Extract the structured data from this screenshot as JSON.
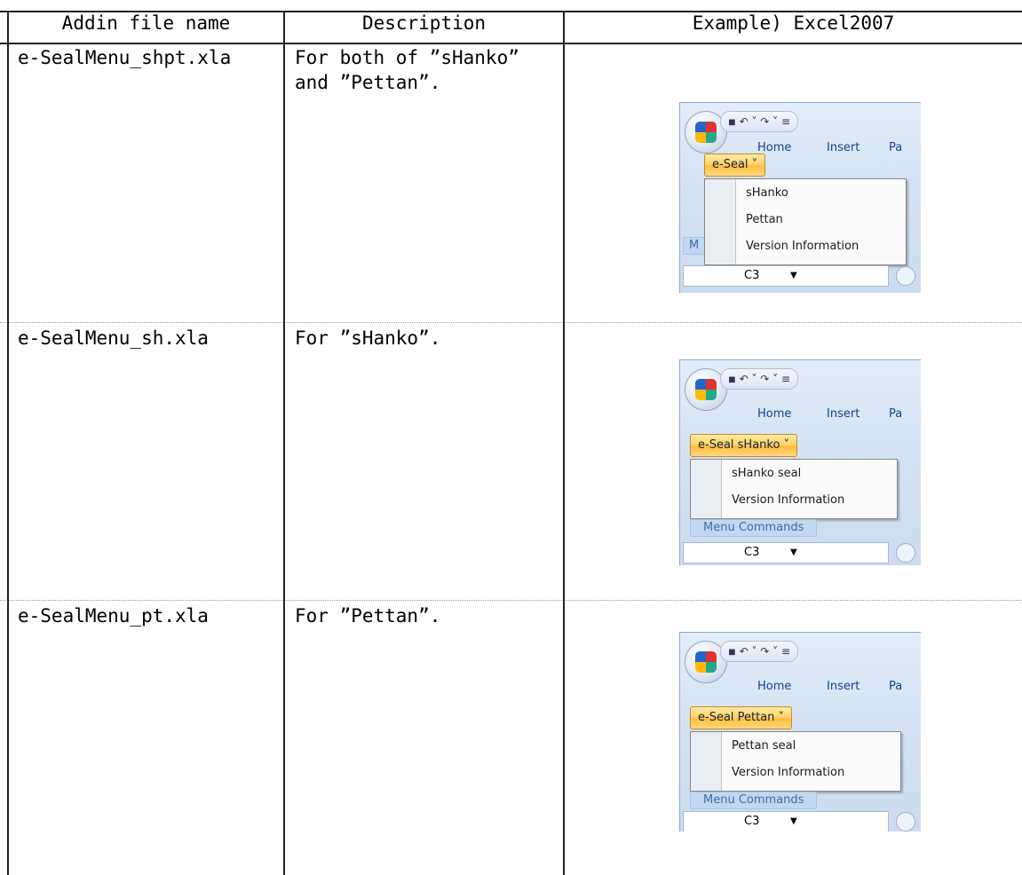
{
  "table": {
    "headers": [
      "Addin file name",
      "Description",
      "Example) Excel2007"
    ],
    "rows": [
      {
        "file": "e-SealMenu_shpt.xla",
        "desc_line1": "For both of ”sHanko”",
        "desc_line2": "and ”Pettan”."
      },
      {
        "file": "e-SealMenu_sh.xla",
        "desc_line1": "For ”sHanko”."
      },
      {
        "file": "e-SealMenu_pt.xla",
        "desc_line1": "For ”Pettan”."
      }
    ]
  },
  "examples": [
    {
      "qat": "◾ ↶ ˅ ↷ ˅ ≡",
      "tabs": [
        "Home",
        "Insert",
        "Pa"
      ],
      "button": "e-Seal ˅",
      "menu_items": [
        "sHanko",
        "Pettan",
        "Version Information"
      ],
      "group_label": "M",
      "namebox": "C3"
    },
    {
      "qat": "◾ ↶ ˅ ↷ ˅ ≡",
      "tabs": [
        "Home",
        "Insert",
        "Pa"
      ],
      "button": "e-Seal sHanko ˅",
      "menu_items": [
        "sHanko seal",
        "Version Information"
      ],
      "group_label": "Menu Commands",
      "namebox": "C3"
    },
    {
      "qat": "◾ ↶ ˅ ↷ ˅ ≡",
      "tabs": [
        "Home",
        "Insert",
        "Pa"
      ],
      "button": "e-Seal Pettan ˅",
      "menu_items": [
        "Pettan seal",
        "Version Information"
      ],
      "group_label": "Menu Commands",
      "namebox": "C3"
    }
  ],
  "colors": {
    "border": "#222222",
    "row_divider": "#9a9a9a",
    "ribbon_button": "#ffd36b",
    "ribbon_text": "#15428b"
  }
}
